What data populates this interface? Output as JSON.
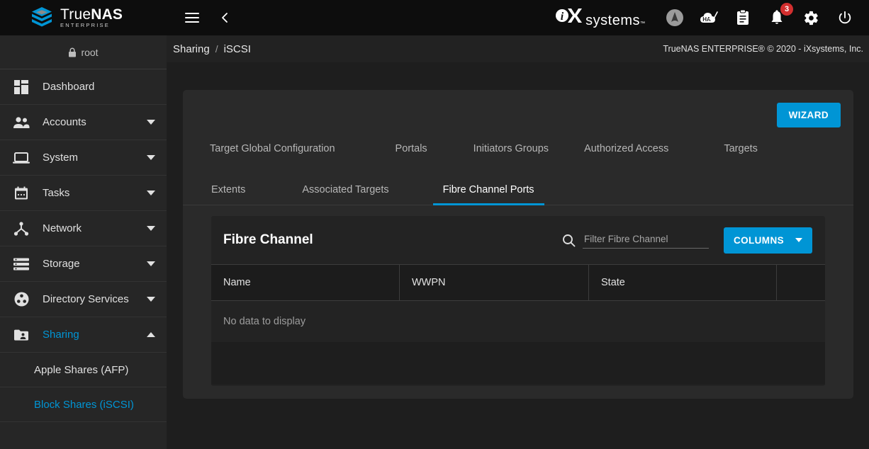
{
  "topbar": {
    "brand": {
      "name_light": "True",
      "name_bold": "NAS",
      "edition": "ENTERPRISE",
      "logo_icon": "truenas-cube-logo"
    },
    "menu_icon": "hamburger-menu-icon",
    "back_icon": "chevron-left-icon",
    "vendor": {
      "word": "systems",
      "tm": "™",
      "mark_icon": "ixsystems-logo"
    },
    "icons": [
      {
        "name": "truecommand-icon",
        "label": "TrueCommand"
      },
      {
        "name": "ha-status-icon",
        "label": "HA"
      },
      {
        "name": "jobs-clipboard-icon",
        "label": "Jobs"
      },
      {
        "name": "notifications-bell-icon",
        "label": "Alerts",
        "badge": "3"
      },
      {
        "name": "settings-gear-icon",
        "label": "Settings"
      },
      {
        "name": "power-icon",
        "label": "Power"
      }
    ]
  },
  "sidebar": {
    "user": {
      "label": "root",
      "icon": "lock-icon"
    },
    "items": [
      {
        "label": "Dashboard",
        "icon": "dashboard-icon",
        "expandable": false,
        "active": false
      },
      {
        "label": "Accounts",
        "icon": "accounts-people-icon",
        "expandable": true,
        "active": false
      },
      {
        "label": "System",
        "icon": "system-laptop-icon",
        "expandable": true,
        "active": false
      },
      {
        "label": "Tasks",
        "icon": "tasks-calendar-icon",
        "expandable": true,
        "active": false
      },
      {
        "label": "Network",
        "icon": "network-nodes-icon",
        "expandable": true,
        "active": false
      },
      {
        "label": "Storage",
        "icon": "storage-stack-icon",
        "expandable": true,
        "active": false
      },
      {
        "label": "Directory Services",
        "icon": "directory-services-icon",
        "expandable": true,
        "active": false
      },
      {
        "label": "Sharing",
        "icon": "sharing-folder-icon",
        "expandable": true,
        "active": true,
        "expanded": true
      }
    ],
    "sub_items": [
      {
        "label": "Apple Shares (AFP)",
        "active": false
      },
      {
        "label": "Block Shares (iSCSI)",
        "active": true
      }
    ]
  },
  "breadcrumb": {
    "parent": "Sharing",
    "separator": "/",
    "current": "iSCSI"
  },
  "copyright": "TrueNAS ENTERPRISE® © 2020 - iXsystems, Inc.",
  "main": {
    "wizard_button": "WIZARD",
    "tabs_primary": [
      {
        "label": "Target Global Configuration",
        "active": false
      },
      {
        "label": "Portals",
        "active": false
      },
      {
        "label": "Initiators Groups",
        "active": false
      },
      {
        "label": "Authorized Access",
        "active": false
      },
      {
        "label": "Targets",
        "active": false
      }
    ],
    "tabs_secondary": [
      {
        "label": "Extents",
        "active": false
      },
      {
        "label": "Associated Targets",
        "active": false
      },
      {
        "label": "Fibre Channel Ports",
        "active": true
      }
    ],
    "panel": {
      "title": "Fibre Channel",
      "search_icon": "search-magnifier-icon",
      "filter_placeholder": "Filter Fibre Channel",
      "filter_value": "",
      "columns_button": "COLUMNS",
      "columns_caret_icon": "chevron-down-icon",
      "table": {
        "headers": [
          "Name",
          "WWPN",
          "State",
          ""
        ],
        "rows": [],
        "empty_message": "No data to display"
      }
    }
  },
  "colors": {
    "accent": "#0095d5",
    "badge": "#d32f2f",
    "topbar_bg": "#0d0d0d",
    "sidebar_bg": "#262626",
    "page_bg": "#1e1e1e",
    "card_bg": "#2a2a2a",
    "panel_bg": "#232323"
  }
}
